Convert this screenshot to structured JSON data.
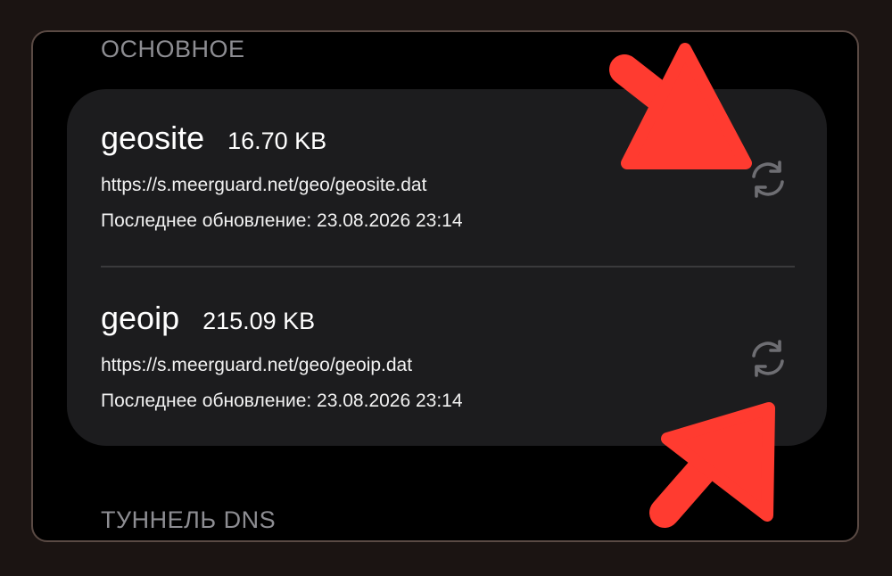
{
  "sections": {
    "main_header": "ОСНОВНОЕ",
    "dns_header": "ТУННЕЛЬ DNS"
  },
  "geo_files": [
    {
      "name": "geosite",
      "size": "16.70 KB",
      "url": "https://s.meerguard.net/geo/geosite.dat",
      "updated": "Последнее обновление: 23.08.2026 23:14",
      "action_icon": "refresh-icon"
    },
    {
      "name": "geoip",
      "size": "215.09 KB",
      "url": "https://s.meerguard.net/geo/geoip.dat",
      "updated": "Последнее обновление: 23.08.2026 23:14",
      "action_icon": "refresh-icon"
    }
  ],
  "annotations": {
    "arrow_color": "#ff3b30",
    "arrow_count": 2
  },
  "colors": {
    "background": "#000000",
    "card": "#1c1c1e",
    "header_text": "#8d8d92",
    "icon": "#6e6e73",
    "divider": "#3a3a3c"
  }
}
